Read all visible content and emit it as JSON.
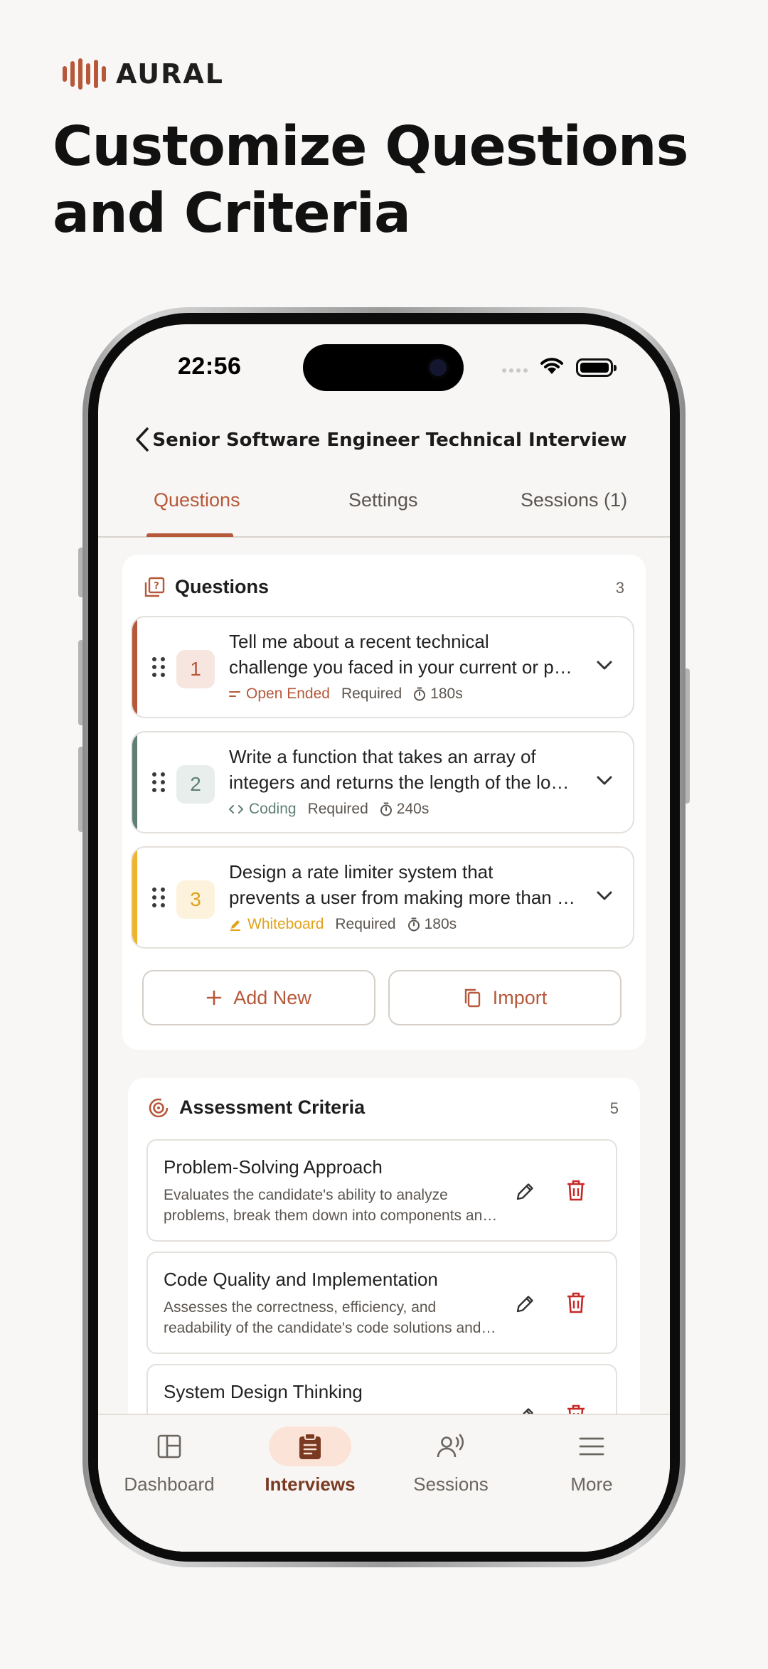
{
  "brand": {
    "name": "AURAL"
  },
  "headline": {
    "line1": "Customize Questions",
    "line2": "and Criteria"
  },
  "status_bar": {
    "time": "22:56"
  },
  "app_bar": {
    "title": "Senior Software Engineer Technical Interview"
  },
  "tabs": [
    {
      "label": "Questions",
      "active": true
    },
    {
      "label": "Settings",
      "active": false
    },
    {
      "label": "Sessions (1)",
      "active": false
    }
  ],
  "questions_card": {
    "title": "Questions",
    "count": "3",
    "icon": "question-list-icon",
    "items": [
      {
        "number": "1",
        "line1": "Tell me about a recent technical",
        "line2": "challenge you faced in your current or previous role and how you solved it.",
        "type": "Open Ended",
        "type_icon": "open-ended-icon",
        "required": "Required",
        "time": "180s",
        "color": "#b6583a",
        "badge_bg": "#f6e6df",
        "badge_fg": "#b6583a"
      },
      {
        "number": "2",
        "line1": "Write a function that takes an array of",
        "line2": "integers and returns the length of the longest increasing subsequence.",
        "type": "Coding",
        "type_icon": "code-icon",
        "required": "Required",
        "time": "240s",
        "color": "#5e7f74",
        "badge_bg": "#e8eeeb",
        "badge_fg": "#5e7f74"
      },
      {
        "number": "3",
        "line1": "Design a rate limiter system that",
        "line2": "prevents a user from making more than N requests per minute.",
        "type": "Whiteboard",
        "type_icon": "whiteboard-icon",
        "required": "Required",
        "time": "180s",
        "color": "#f0b429",
        "badge_bg": "#fdf2dc",
        "badge_fg": "#e0a21c"
      }
    ],
    "add_button": "Add New",
    "import_button": "Import"
  },
  "assessment_card": {
    "title": "Assessment Criteria",
    "count": "5",
    "icon": "target-icon",
    "items": [
      {
        "title": "Problem-Solving Approach",
        "desc1": "Evaluates the candidate's ability to analyze",
        "desc2": "problems, break them down into components and reason about solutions."
      },
      {
        "title": "Code Quality and Implementation",
        "desc1": "Assesses the correctness, efficiency, and",
        "desc2": "readability of the candidate's code solutions and implementations."
      },
      {
        "title": "System Design Thinking",
        "desc1": "",
        "desc2": ""
      }
    ]
  },
  "bottom_nav": [
    {
      "label": "Dashboard",
      "icon": "dashboard-icon",
      "active": false
    },
    {
      "label": "Interviews",
      "icon": "clipboard-icon",
      "active": true
    },
    {
      "label": "Sessions",
      "icon": "sessions-icon",
      "active": false
    },
    {
      "label": "More",
      "icon": "menu-icon",
      "active": false
    }
  ],
  "colors": {
    "accent": "#b6583a",
    "danger": "#c62828",
    "background": "#f7f6f4"
  }
}
